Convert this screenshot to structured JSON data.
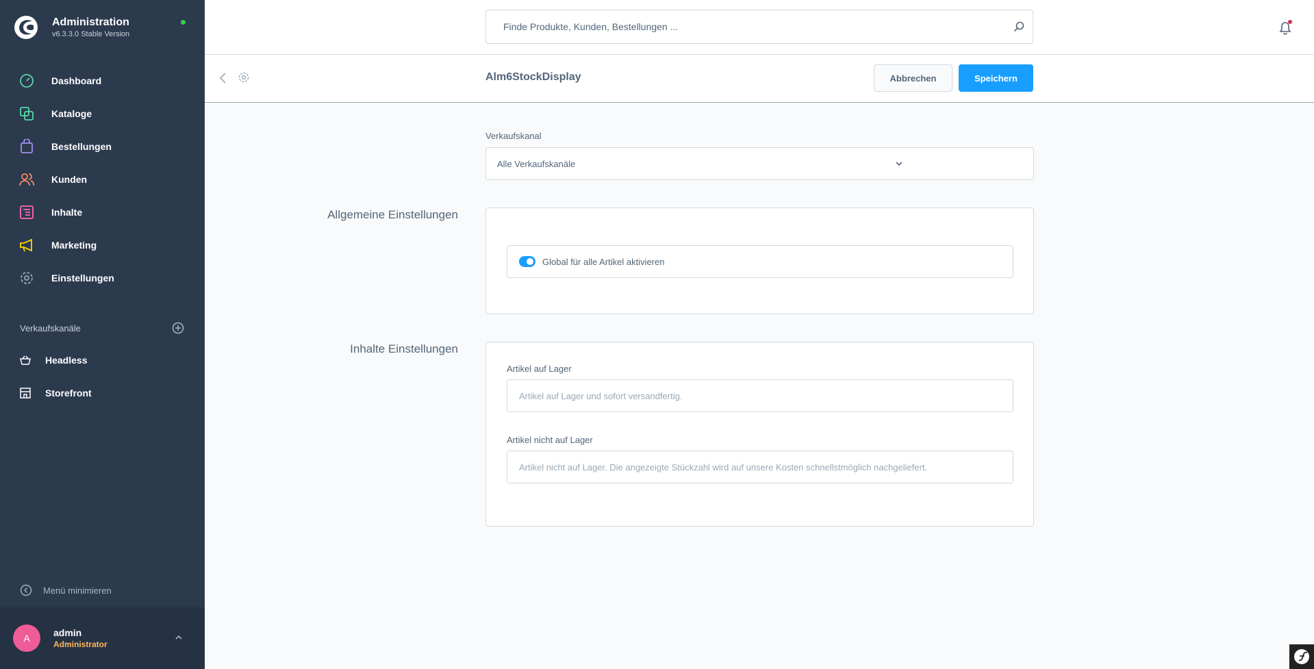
{
  "brand": {
    "title": "Administration",
    "version": "v6.3.3.0 Stable Version",
    "status_color": "#37d046"
  },
  "sidebar": {
    "items": [
      {
        "label": "Dashboard",
        "icon": "gauge-icon",
        "color": "#57d9a3"
      },
      {
        "label": "Kataloge",
        "icon": "catalog-icon",
        "color": "#57d9a3"
      },
      {
        "label": "Bestellungen",
        "icon": "shopping-bag-icon",
        "color": "#a092f0"
      },
      {
        "label": "Kunden",
        "icon": "users-icon",
        "color": "#f88962"
      },
      {
        "label": "Inhalte",
        "icon": "content-icon",
        "color": "#ff68b4"
      },
      {
        "label": "Marketing",
        "icon": "megaphone-icon",
        "color": "#ffd700"
      },
      {
        "label": "Einstellungen",
        "icon": "gear-icon",
        "color": "#9aa8b5"
      }
    ],
    "sales_channels_title": "Verkaufskanäle",
    "sales_channels": [
      {
        "label": "Headless",
        "icon": "basket-icon"
      },
      {
        "label": "Storefront",
        "icon": "storefront-icon"
      }
    ],
    "minimize_label": "Menü minimieren"
  },
  "user": {
    "initial": "A",
    "name": "admin",
    "role": "Administrator"
  },
  "search": {
    "placeholder": "Finde Produkte, Kunden, Bestellungen ..."
  },
  "smartbar": {
    "title": "Alm6StockDisplay",
    "cancel_label": "Abbrechen",
    "save_label": "Speichern"
  },
  "sales_channel_select": {
    "label": "Verkaufskanal",
    "value": "Alle Verkaufskanäle"
  },
  "general_settings": {
    "title": "Allgemeine Einstellungen",
    "toggle_label": "Global für alle Artikel aktivieren",
    "toggle_on": true
  },
  "content_settings": {
    "title": "Inhalte Einstellungen",
    "in_stock_label": "Artikel auf Lager",
    "in_stock_placeholder": "Artikel auf Lager und sofort versandfertig.",
    "out_of_stock_label": "Artikel nicht auf Lager",
    "out_of_stock_placeholder": "Artikel nicht auf Lager. Die angezeigte Stückzahl wird auf unsere Kosten schnellstmöglich nachgeliefert."
  },
  "colors": {
    "accent": "#189eff",
    "sidebar_bg": "#2c3a4e",
    "avatar": "#ef5c98",
    "role": "#ffb75d"
  }
}
